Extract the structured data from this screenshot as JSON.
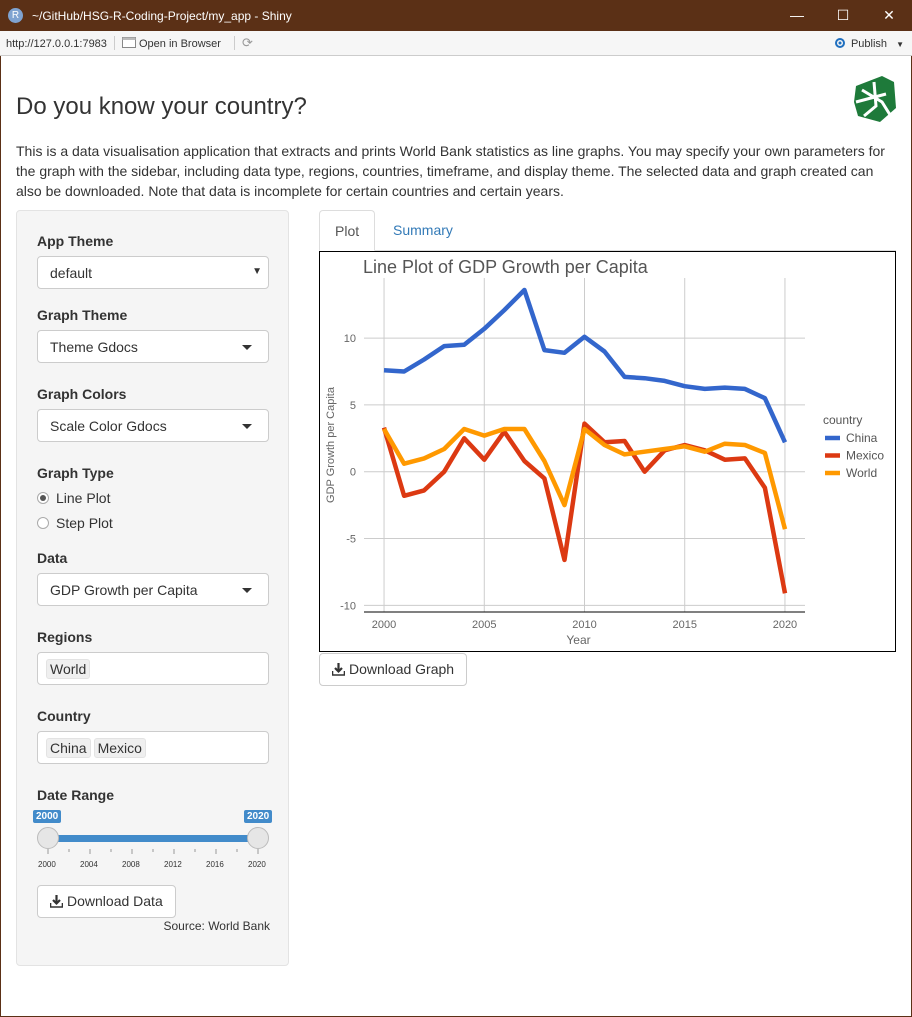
{
  "window": {
    "title": "~/GitHub/HSG-R-Coding-Project/my_app - Shiny",
    "minimize": "—",
    "maximize": "☐",
    "close": "✕"
  },
  "toolbar": {
    "url": "http://127.0.0.1:7983",
    "open_browser": "Open in Browser",
    "publish": "Publish"
  },
  "page": {
    "title": "Do you know your country?",
    "intro": "This is a data visualisation application that extracts and prints World Bank statistics as line graphs. You may specify your own parameters for the graph with the sidebar, including data type, regions, countries, timeframe, and display theme. The selected data and graph created can also be downloaded. Note that data is incomplete for certain countries and certain years."
  },
  "sidebar": {
    "app_theme": {
      "label": "App Theme",
      "value": "default"
    },
    "graph_theme": {
      "label": "Graph Theme",
      "value": "Theme Gdocs"
    },
    "graph_colors": {
      "label": "Graph Colors",
      "value": "Scale Color Gdocs"
    },
    "graph_type": {
      "label": "Graph Type",
      "options": [
        "Line Plot",
        "Step Plot"
      ],
      "selected": "Line Plot"
    },
    "data": {
      "label": "Data",
      "value": "GDP Growth per Capita"
    },
    "regions": {
      "label": "Regions",
      "tags": [
        "World"
      ]
    },
    "country": {
      "label": "Country",
      "tags": [
        "China",
        "Mexico"
      ]
    },
    "date_range": {
      "label": "Date Range",
      "from": "2000",
      "to": "2020",
      "ticks": [
        "2000",
        "2004",
        "2008",
        "2012",
        "2016",
        "2020"
      ]
    },
    "download_data": "Download Data",
    "source": "Source: World Bank"
  },
  "tabs": [
    {
      "label": "Plot",
      "active": true
    },
    {
      "label": "Summary",
      "active": false
    }
  ],
  "download_graph": "Download Graph",
  "chart_data": {
    "type": "line",
    "title": "Line Plot of GDP Growth per Capita",
    "xlabel": "Year",
    "ylabel": "GDP Growth per Capita",
    "legend_title": "country",
    "legend_position": "right",
    "grid": true,
    "xlim": [
      1999,
      2021
    ],
    "ylim": [
      -10.5,
      14.5
    ],
    "xticks": [
      2000,
      2005,
      2010,
      2015,
      2020
    ],
    "yticks": [
      -10,
      -5,
      0,
      5,
      10
    ],
    "x": [
      2000,
      2001,
      2002,
      2003,
      2004,
      2005,
      2006,
      2007,
      2008,
      2009,
      2010,
      2011,
      2012,
      2013,
      2014,
      2015,
      2016,
      2017,
      2018,
      2019,
      2020
    ],
    "series": [
      {
        "name": "China",
        "color": "#3366cc",
        "values": [
          7.6,
          7.5,
          8.4,
          9.4,
          9.5,
          10.7,
          12.1,
          13.6,
          9.1,
          8.9,
          10.1,
          9.0,
          7.1,
          7.0,
          6.8,
          6.4,
          6.2,
          6.3,
          6.2,
          5.5,
          2.2
        ]
      },
      {
        "name": "Mexico",
        "color": "#dc3912",
        "values": [
          3.3,
          -1.8,
          -1.4,
          0.0,
          2.5,
          0.9,
          3.0,
          0.8,
          -0.5,
          -6.6,
          3.6,
          2.2,
          2.3,
          0.0,
          1.6,
          2.0,
          1.6,
          0.9,
          1.0,
          -1.2,
          -9.1
        ]
      },
      {
        "name": "World",
        "color": "#ff9900",
        "values": [
          3.2,
          0.6,
          1.0,
          1.7,
          3.2,
          2.7,
          3.2,
          3.2,
          0.8,
          -2.5,
          3.2,
          2.0,
          1.3,
          1.5,
          1.7,
          1.9,
          1.5,
          2.1,
          2.0,
          1.4,
          -4.3
        ]
      }
    ]
  }
}
